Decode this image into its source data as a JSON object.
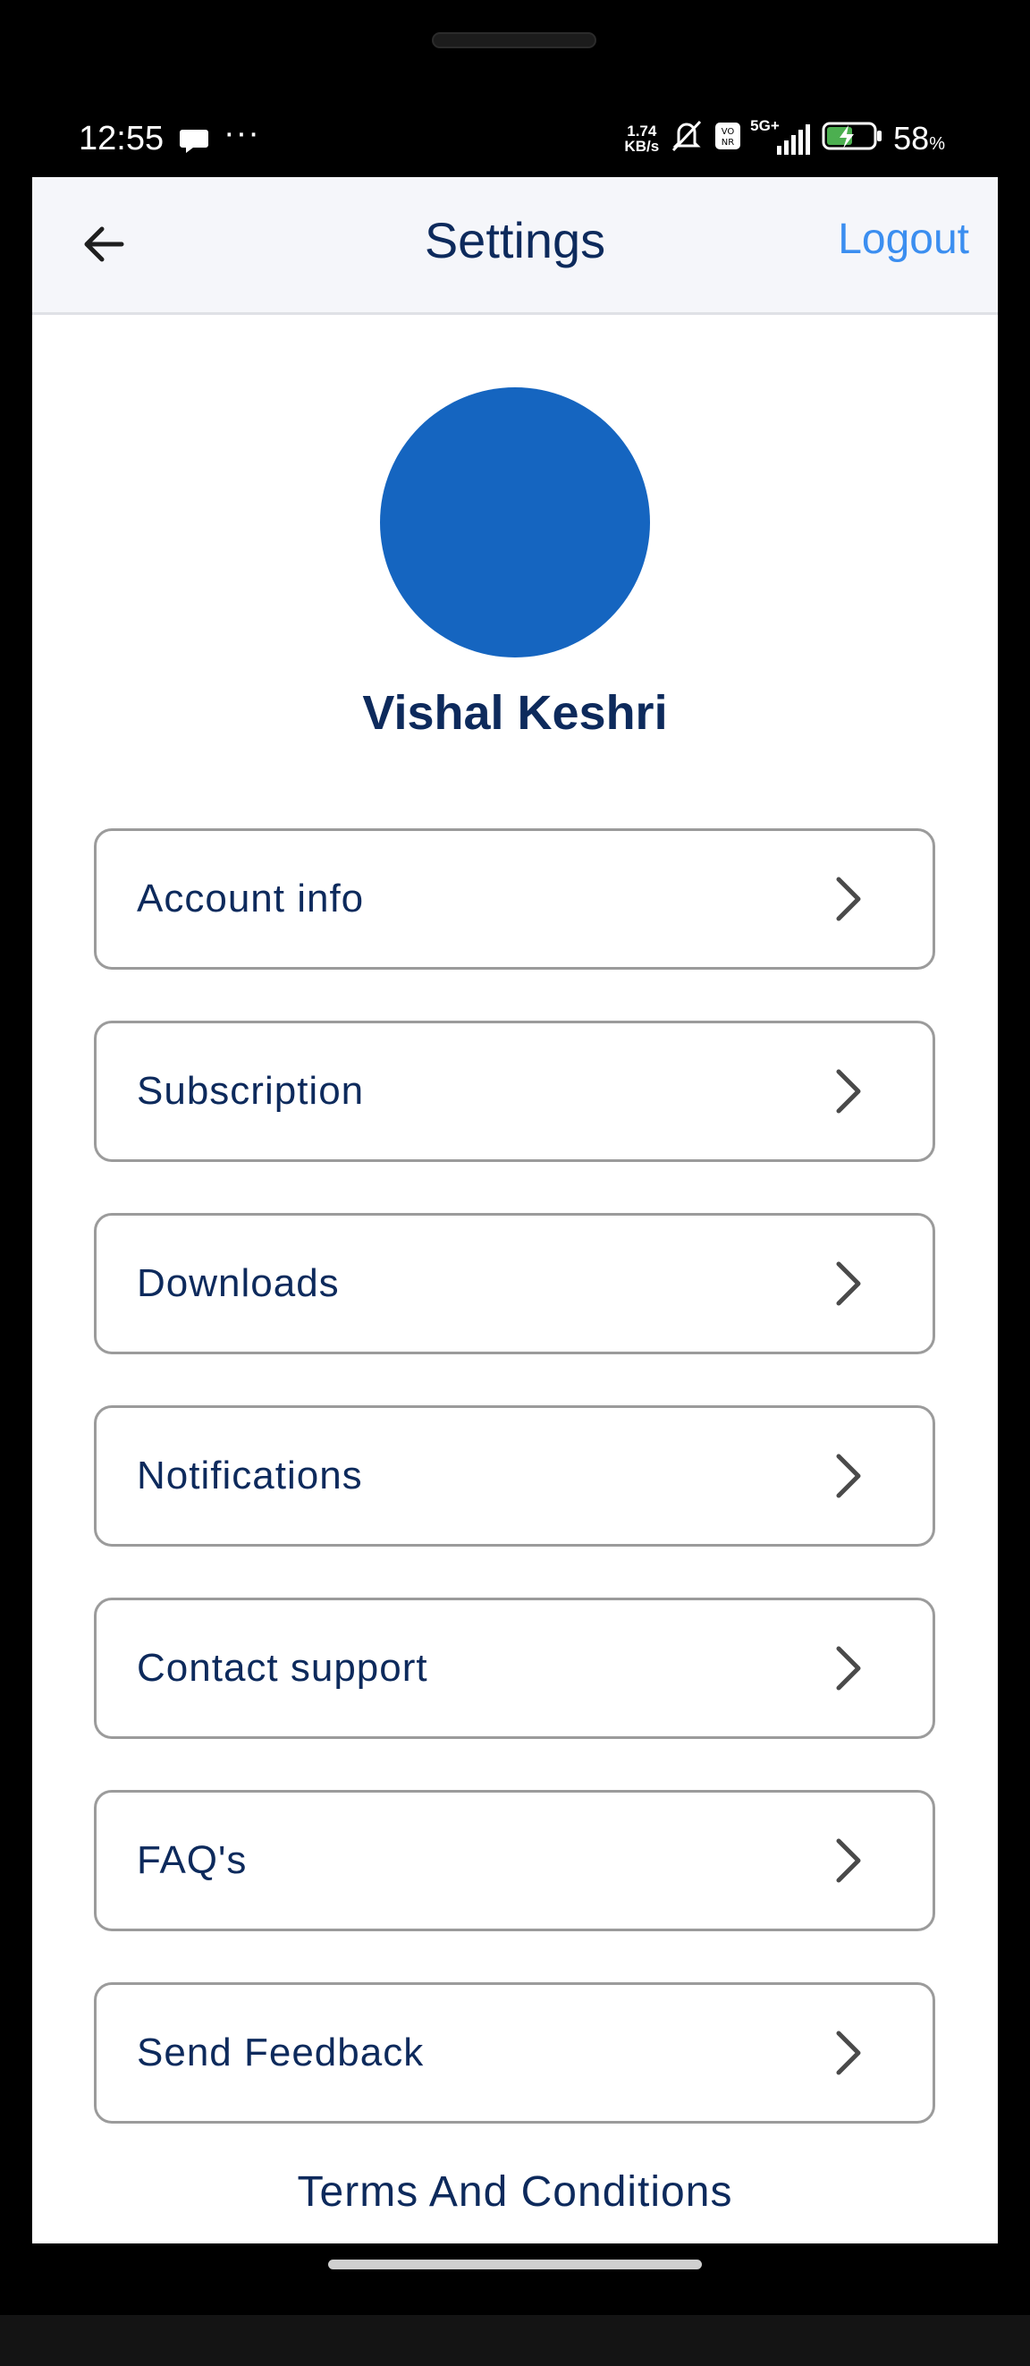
{
  "status_bar": {
    "time": "12:55",
    "speed_value": "1.74",
    "speed_unit": "KB/s",
    "network": "5G+",
    "battery_percent": "58",
    "battery_unit": "%"
  },
  "header": {
    "title": "Settings",
    "logout_label": "Logout"
  },
  "profile": {
    "name": "Vishal Keshri",
    "avatar_color": "#1565c0"
  },
  "menu": {
    "items": [
      {
        "label": "Account info"
      },
      {
        "label": "Subscription"
      },
      {
        "label": "Downloads"
      },
      {
        "label": "Notifications"
      },
      {
        "label": "Contact support"
      },
      {
        "label": "FAQ's"
      },
      {
        "label": "Send Feedback"
      }
    ]
  },
  "footer": {
    "terms_label": "Terms And Conditions"
  },
  "colors": {
    "primary_text": "#0d2a5c",
    "link": "#3b8ef0",
    "border": "#9b9b9b"
  }
}
